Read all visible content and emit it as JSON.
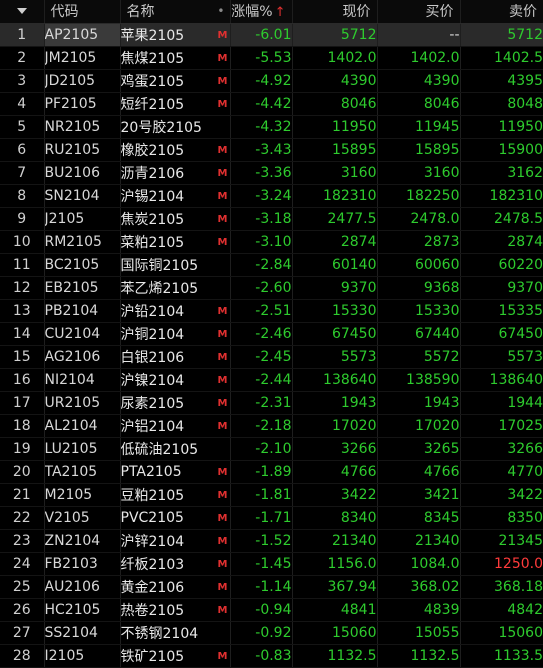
{
  "header": {
    "code": "代码",
    "name": "名称",
    "name_dot": "•",
    "change": "涨幅%",
    "sort_arrow": "↑",
    "price": "现价",
    "bid": "买价",
    "ask": "卖价"
  },
  "colors": {
    "down": "#2ecb2e",
    "up": "#ff3b3b",
    "neutral": "#d8d8d8",
    "marker": "#e03030"
  },
  "rows": [
    {
      "no": "1",
      "code": "AP2105",
      "name": "苹果2105",
      "mark": "M",
      "change": "-6.01",
      "price": "5712",
      "bid": "--",
      "ask": "5712"
    },
    {
      "no": "2",
      "code": "JM2105",
      "name": "焦煤2105",
      "mark": "M",
      "change": "-5.53",
      "price": "1402.0",
      "bid": "1402.0",
      "ask": "1402.5"
    },
    {
      "no": "3",
      "code": "JD2105",
      "name": "鸡蛋2105",
      "mark": "M",
      "change": "-4.92",
      "price": "4390",
      "bid": "4390",
      "ask": "4395"
    },
    {
      "no": "4",
      "code": "PF2105",
      "name": "短纤2105",
      "mark": "M",
      "change": "-4.42",
      "price": "8046",
      "bid": "8046",
      "ask": "8048"
    },
    {
      "no": "5",
      "code": "NR2105",
      "name": "20号胶2105",
      "mark": "",
      "change": "-4.32",
      "price": "11950",
      "bid": "11945",
      "ask": "11950"
    },
    {
      "no": "6",
      "code": "RU2105",
      "name": "橡胶2105",
      "mark": "M",
      "change": "-3.43",
      "price": "15895",
      "bid": "15895",
      "ask": "15900"
    },
    {
      "no": "7",
      "code": "BU2106",
      "name": "沥青2106",
      "mark": "M",
      "change": "-3.36",
      "price": "3160",
      "bid": "3160",
      "ask": "3162"
    },
    {
      "no": "8",
      "code": "SN2104",
      "name": "沪锡2104",
      "mark": "M",
      "change": "-3.24",
      "price": "182310",
      "bid": "182250",
      "ask": "182310"
    },
    {
      "no": "9",
      "code": "J2105",
      "name": "焦炭2105",
      "mark": "M",
      "change": "-3.18",
      "price": "2477.5",
      "bid": "2478.0",
      "ask": "2478.5"
    },
    {
      "no": "10",
      "code": "RM2105",
      "name": "菜粕2105",
      "mark": "M",
      "change": "-3.10",
      "price": "2874",
      "bid": "2873",
      "ask": "2874"
    },
    {
      "no": "11",
      "code": "BC2105",
      "name": "国际铜2105",
      "mark": "",
      "change": "-2.84",
      "price": "60140",
      "bid": "60060",
      "ask": "60220"
    },
    {
      "no": "12",
      "code": "EB2105",
      "name": "苯乙烯2105",
      "mark": "",
      "change": "-2.60",
      "price": "9370",
      "bid": "9368",
      "ask": "9370"
    },
    {
      "no": "13",
      "code": "PB2104",
      "name": "沪铅2104",
      "mark": "M",
      "change": "-2.51",
      "price": "15330",
      "bid": "15330",
      "ask": "15335"
    },
    {
      "no": "14",
      "code": "CU2104",
      "name": "沪铜2104",
      "mark": "M",
      "change": "-2.46",
      "price": "67450",
      "bid": "67440",
      "ask": "67450"
    },
    {
      "no": "15",
      "code": "AG2106",
      "name": "白银2106",
      "mark": "M",
      "change": "-2.45",
      "price": "5573",
      "bid": "5572",
      "ask": "5573"
    },
    {
      "no": "16",
      "code": "NI2104",
      "name": "沪镍2104",
      "mark": "M",
      "change": "-2.44",
      "price": "138640",
      "bid": "138590",
      "ask": "138640"
    },
    {
      "no": "17",
      "code": "UR2105",
      "name": "尿素2105",
      "mark": "M",
      "change": "-2.31",
      "price": "1943",
      "bid": "1943",
      "ask": "1944"
    },
    {
      "no": "18",
      "code": "AL2104",
      "name": "沪铝2104",
      "mark": "M",
      "change": "-2.18",
      "price": "17020",
      "bid": "17020",
      "ask": "17025"
    },
    {
      "no": "19",
      "code": "LU2105",
      "name": "低硫油2105",
      "mark": "",
      "change": "-2.10",
      "price": "3266",
      "bid": "3265",
      "ask": "3266"
    },
    {
      "no": "20",
      "code": "TA2105",
      "name": "PTA2105",
      "mark": "M",
      "change": "-1.89",
      "price": "4766",
      "bid": "4766",
      "ask": "4770"
    },
    {
      "no": "21",
      "code": "M2105",
      "name": "豆粕2105",
      "mark": "M",
      "change": "-1.81",
      "price": "3422",
      "bid": "3421",
      "ask": "3422"
    },
    {
      "no": "22",
      "code": "V2105",
      "name": "PVC2105",
      "mark": "M",
      "change": "-1.71",
      "price": "8340",
      "bid": "8345",
      "ask": "8350"
    },
    {
      "no": "23",
      "code": "ZN2104",
      "name": "沪锌2104",
      "mark": "M",
      "change": "-1.52",
      "price": "21340",
      "bid": "21340",
      "ask": "21345"
    },
    {
      "no": "24",
      "code": "FB2103",
      "name": "纤板2103",
      "mark": "M",
      "change": "-1.45",
      "price": "1156.0",
      "bid": "1084.0",
      "ask": "1250.0"
    },
    {
      "no": "25",
      "code": "AU2106",
      "name": "黄金2106",
      "mark": "M",
      "change": "-1.14",
      "price": "367.94",
      "bid": "368.02",
      "ask": "368.18"
    },
    {
      "no": "26",
      "code": "HC2105",
      "name": "热卷2105",
      "mark": "M",
      "change": "-0.94",
      "price": "4841",
      "bid": "4839",
      "ask": "4842"
    },
    {
      "no": "27",
      "code": "SS2104",
      "name": "不锈钢2104",
      "mark": "",
      "change": "-0.92",
      "price": "15060",
      "bid": "15055",
      "ask": "15060"
    },
    {
      "no": "28",
      "code": "I2105",
      "name": "铁矿2105",
      "mark": "M",
      "change": "-0.83",
      "price": "1132.5",
      "bid": "1132.5",
      "ask": "1133.5"
    }
  ],
  "row_colors": {
    "bid_neutral_row": "1",
    "ask_red_row": "24"
  }
}
